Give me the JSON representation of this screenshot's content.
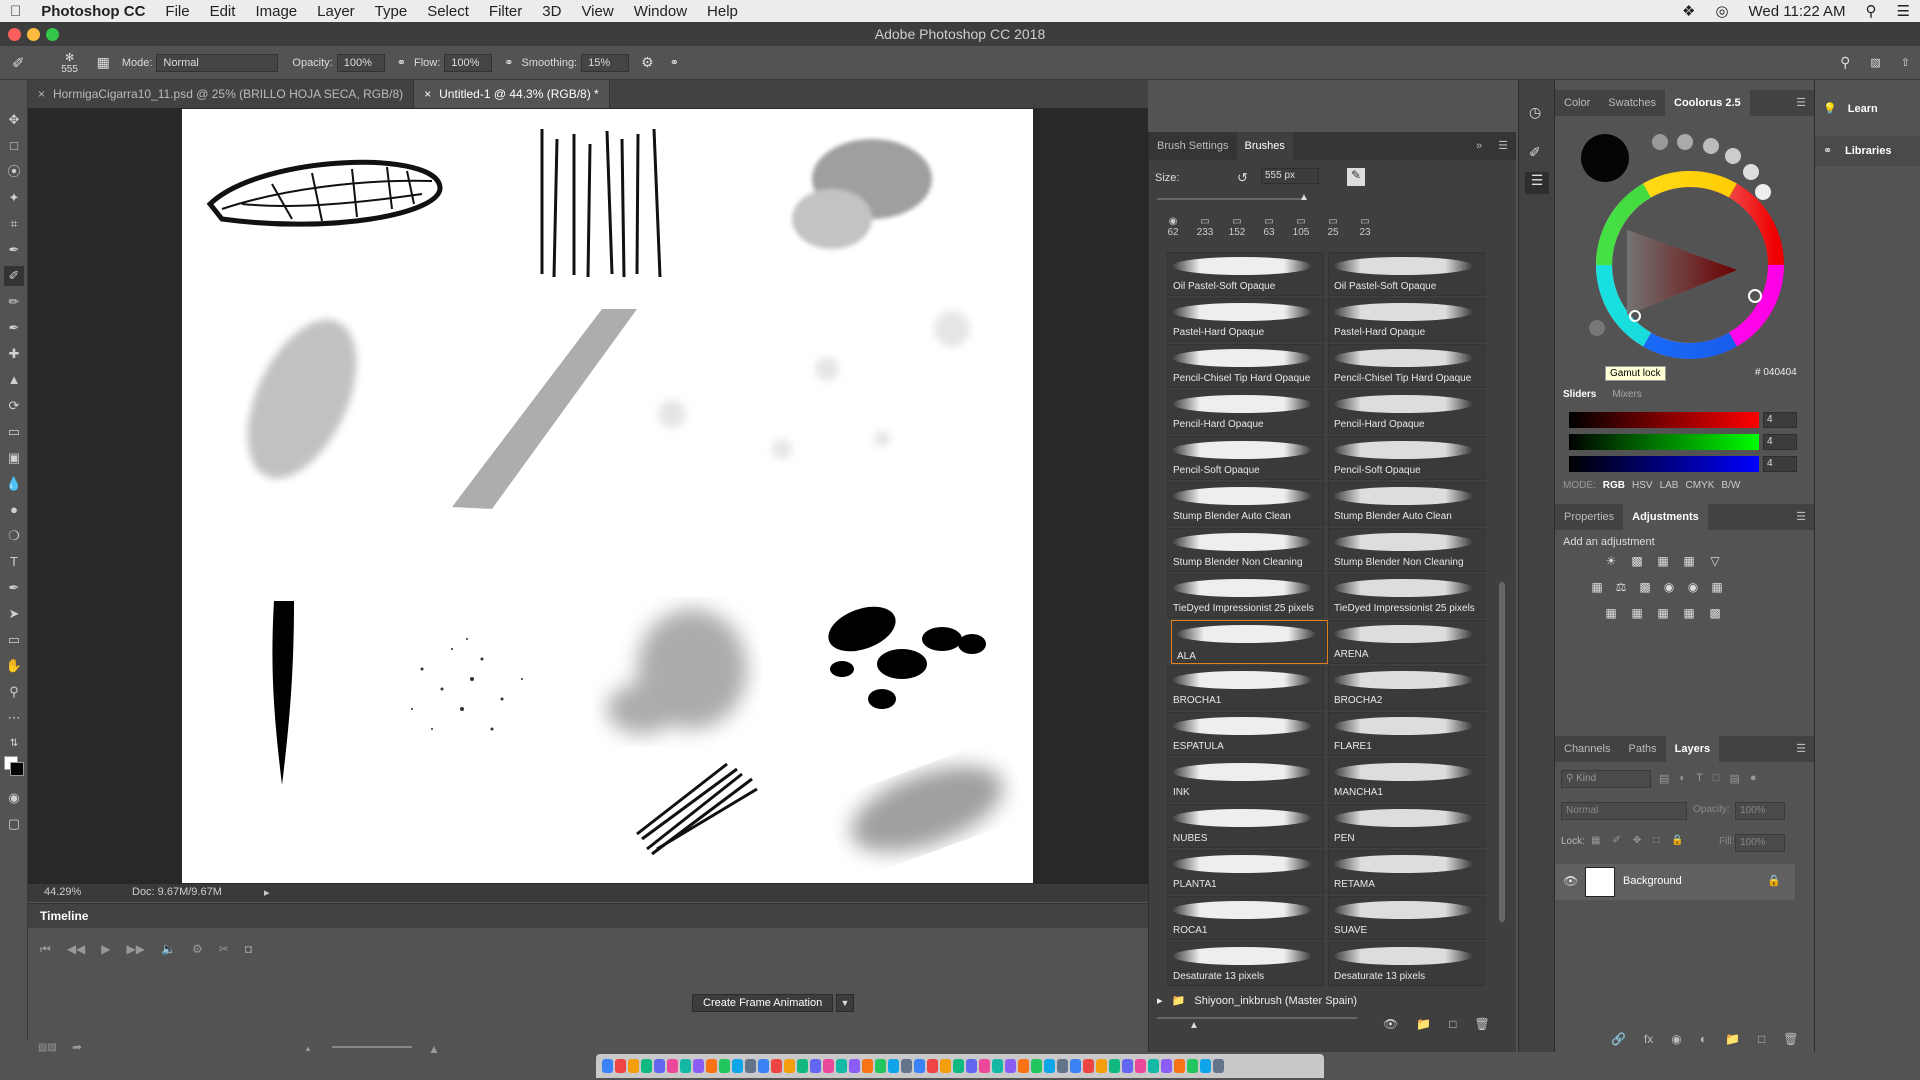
{
  "menubar": {
    "apple": "",
    "items": [
      "Photoshop CC",
      "File",
      "Edit",
      "Image",
      "Layer",
      "Type",
      "Select",
      "Filter",
      "3D",
      "View",
      "Window",
      "Help"
    ],
    "clock": "Wed 11:22 AM"
  },
  "window": {
    "title": "Adobe Photoshop CC 2018"
  },
  "options": {
    "brush_size": "555",
    "mode_label": "Mode:",
    "mode_value": "Normal",
    "opacity_label": "Opacity:",
    "opacity_value": "100%",
    "flow_label": "Flow:",
    "flow_value": "100%",
    "smoothing_label": "Smoothing:",
    "smoothing_value": "15%"
  },
  "doc_tabs": [
    {
      "label": "HormigaCigarra10_11.psd @ 25% (BRILLO HOJA SECA, RGB/8)"
    },
    {
      "label": "Untitled-1 @ 44.3% (RGB/8) *"
    }
  ],
  "status": {
    "zoom": "44.29%",
    "doc": "Doc: 9.67M/9.67M"
  },
  "timeline": {
    "title": "Timeline",
    "create_button": "Create Frame Animation"
  },
  "brush_panel": {
    "tabs": [
      "Brush Settings",
      "Brushes"
    ],
    "size_label": "Size:",
    "size_value": "555 px",
    "presets": [
      "62",
      "233",
      "152",
      "63",
      "105",
      "25",
      "23"
    ],
    "brushes": [
      "Oil Pastel-Soft Opaque",
      "Oil Pastel-Soft Opaque",
      "Pastel-Hard Opaque",
      "Pastel-Hard Opaque",
      "Pencil-Chisel Tip Hard Opaque",
      "Pencil-Chisel Tip Hard Opaque",
      "Pencil-Hard Opaque",
      "Pencil-Hard Opaque",
      "Pencil-Soft Opaque",
      "Pencil-Soft Opaque",
      "Stump Blender Auto Clean",
      "Stump Blender Auto Clean",
      "Stump Blender Non Cleaning",
      "Stump Blender Non Cleaning",
      "TieDyed Impressionist 25 pixels",
      "TieDyed Impressionist 25 pixels",
      "ALA",
      "ARENA",
      "BROCHA1",
      "BROCHA2",
      "ESPATULA",
      "FLARE1",
      "INK",
      "MANCHA1",
      "NUBES",
      "PEN",
      "PLANTA1",
      "RETAMA",
      "ROCA1",
      "SUAVE",
      "Desaturate 13 pixels",
      "Desaturate 13 pixels"
    ],
    "folder": "Shiyoon_inkbrush (Master Spain)"
  },
  "color_panel": {
    "tabs": [
      "Color",
      "Swatches",
      "Coolorus 2.5"
    ],
    "tooltip": "Gamut lock",
    "hex": "040404",
    "sub_tabs": [
      "Sliders",
      "Mixers"
    ],
    "slider_values": [
      "4",
      "4",
      "4"
    ],
    "modes_label": "MODE:",
    "modes": [
      "RGB",
      "HSV",
      "LAB",
      "CMYK",
      "B/W"
    ]
  },
  "adjustments": {
    "tabs": [
      "Properties",
      "Adjustments"
    ],
    "add_label": "Add an adjustment"
  },
  "layers": {
    "tabs": [
      "Channels",
      "Paths",
      "Layers"
    ],
    "kind": "Kind",
    "blend": "Normal",
    "opacity_label": "Opacity:",
    "opacity_value": "100%",
    "lock_label": "Lock:",
    "fill_label": "Fill:",
    "fill_value": "100%",
    "layer_name": "Background"
  },
  "far_right": {
    "learn": "Learn",
    "libraries": "Libraries"
  }
}
